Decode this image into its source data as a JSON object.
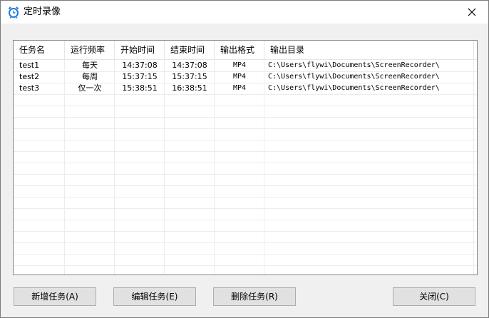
{
  "window": {
    "title": "定时录像"
  },
  "table": {
    "columns": [
      "任务名",
      "运行频率",
      "开始时间",
      "结束时间",
      "输出格式",
      "输出目录"
    ],
    "rows": [
      [
        "test1",
        "每天",
        "14:37:08",
        "14:37:08",
        "MP4",
        "C:\\Users\\flywi\\Documents\\ScreenRecorder\\"
      ],
      [
        "test2",
        "每周",
        "15:37:15",
        "15:37:15",
        "MP4",
        "C:\\Users\\flywi\\Documents\\ScreenRecorder\\"
      ],
      [
        "test3",
        "仅一次",
        "15:38:51",
        "16:38:51",
        "MP4",
        "C:\\Users\\flywi\\Documents\\ScreenRecorder\\"
      ]
    ]
  },
  "buttons": {
    "add": "新增任务(A)",
    "edit": "编辑任务(E)",
    "delete": "删除任务(R)",
    "close": "关闭(C)"
  },
  "icons": {
    "title_icon": "alarm-clock-icon",
    "close": "close-icon"
  },
  "colors": {
    "accent": "#1e7be0",
    "list_bg": "#ffffff",
    "window_bg": "#f0f0f0"
  }
}
